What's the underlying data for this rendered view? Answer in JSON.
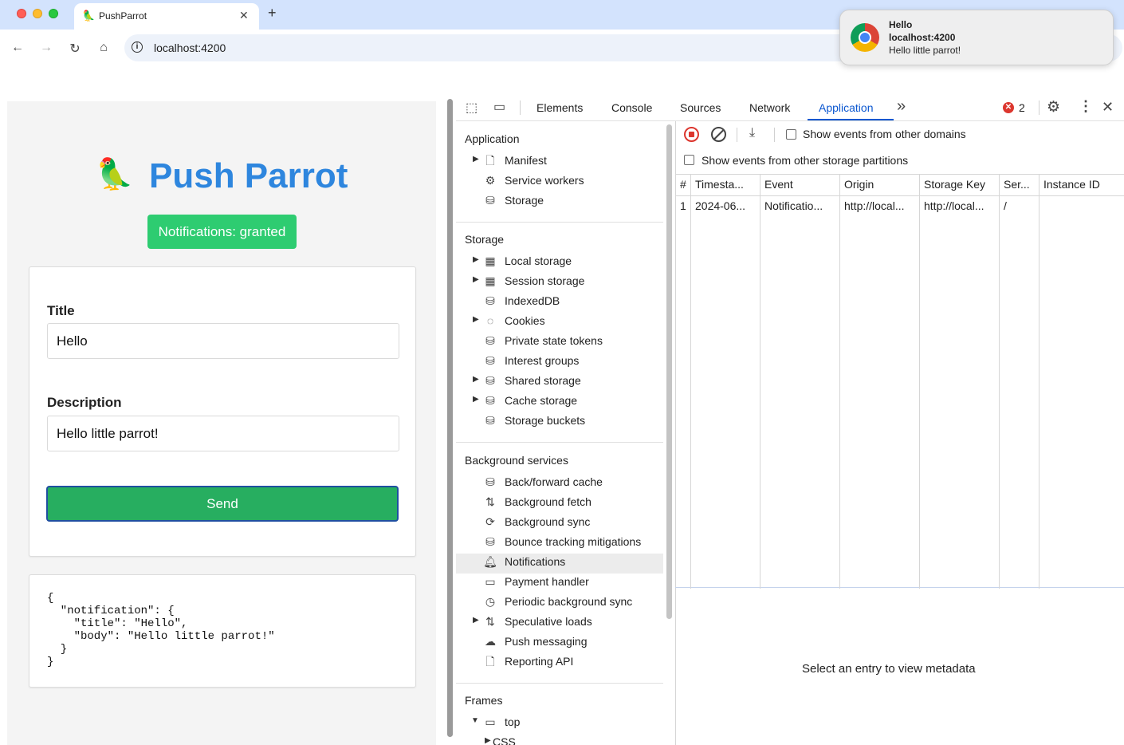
{
  "browser": {
    "tab_title": "PushParrot",
    "tab_icon": "parrot-icon",
    "new_tab": "+",
    "tab_close": "✕",
    "url": "localhost:4200"
  },
  "system_notification": {
    "title": "Hello",
    "origin": "localhost:4200",
    "body": "Hello little parrot!",
    "icon": "chrome-icon"
  },
  "app": {
    "brand": "Push Parrot",
    "brand_emoji": "🦜",
    "permission_badge": "Notifications: granted",
    "title_label": "Title",
    "title_value": "Hello",
    "description_label": "Description",
    "description_value": "Hello little parrot!",
    "send_label": "Send",
    "json_output": "{\n  \"notification\": {\n    \"title\": \"Hello\",\n    \"body\": \"Hello little parrot!\"\n  }\n}",
    "colors": {
      "brand": "#2e86de",
      "badge": "#2ecc71",
      "send": "#27ae60"
    }
  },
  "devtools": {
    "tabs": [
      "Elements",
      "Console",
      "Sources",
      "Network",
      "Application"
    ],
    "active_tab": "Application",
    "more_tabs": "»",
    "error_count": "2",
    "sidebar": {
      "application": {
        "heading": "Application",
        "items": [
          "Manifest",
          "Service workers",
          "Storage"
        ]
      },
      "storage": {
        "heading": "Storage",
        "items": [
          "Local storage",
          "Session storage",
          "IndexedDB",
          "Cookies",
          "Private state tokens",
          "Interest groups",
          "Shared storage",
          "Cache storage",
          "Storage buckets"
        ]
      },
      "background": {
        "heading": "Background services",
        "items": [
          "Back/forward cache",
          "Background fetch",
          "Background sync",
          "Bounce tracking mitigations",
          "Notifications",
          "Payment handler",
          "Periodic background sync",
          "Speculative loads",
          "Push messaging",
          "Reporting API"
        ]
      },
      "frames": {
        "heading": "Frames",
        "items": [
          "top",
          "CSS"
        ]
      }
    },
    "toolbar": {
      "show_other_domains": "Show events from other domains",
      "show_other_partitions": "Show events from other storage partitions"
    },
    "grid": {
      "columns": [
        "#",
        "Timesta...",
        "Event",
        "Origin",
        "Storage Key",
        "Ser...",
        "Instance ID"
      ],
      "rows": [
        [
          "1",
          "2024-06...",
          "Notificatio...",
          "http://local...",
          "http://local...",
          "/",
          ""
        ]
      ]
    },
    "empty_metadata": "Select an entry to view metadata"
  }
}
